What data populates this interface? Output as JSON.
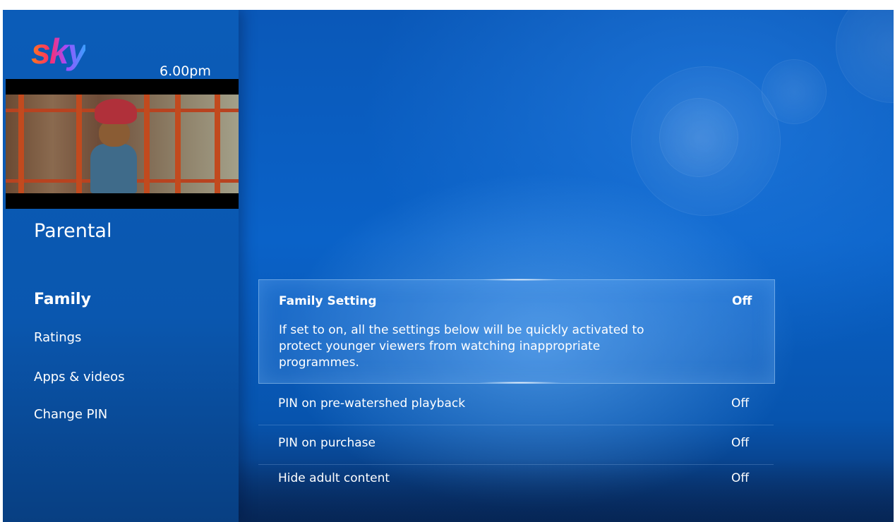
{
  "header": {
    "logo_text": "sky",
    "time": "6.00pm"
  },
  "sidebar": {
    "section_title": "Parental",
    "items": [
      {
        "label": "Family",
        "active": true
      },
      {
        "label": "Ratings",
        "active": false
      },
      {
        "label": "Apps & videos",
        "active": false
      },
      {
        "label": "Change PIN",
        "active": false
      }
    ]
  },
  "settings": {
    "selected": {
      "label": "Family Setting",
      "value": "Off",
      "description": "If set to on, all the settings below will be quickly activated to protect younger viewers from watching inappropriate programmes."
    },
    "rows": [
      {
        "label": "PIN on pre-watershed playback",
        "value": "Off"
      },
      {
        "label": "PIN on purchase",
        "value": "Off"
      },
      {
        "label": "Hide adult content",
        "value": "Off"
      }
    ]
  },
  "colors": {
    "background_blue": "#0a5fc2",
    "sidebar_blue": "#0b5cb8",
    "text": "#ffffff"
  }
}
